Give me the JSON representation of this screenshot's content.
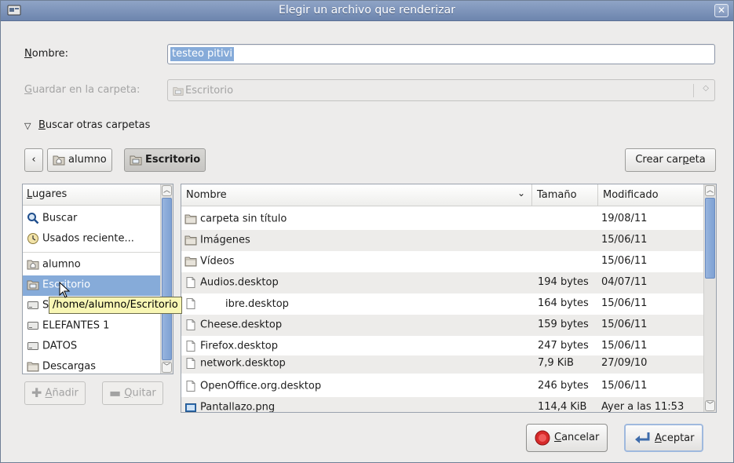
{
  "window": {
    "title": "Elegir un archivo que renderizar",
    "close_symbol": "✕"
  },
  "name_field": {
    "label_mnemonic": "N",
    "label_rest": "ombre:",
    "value": "testeo pitivi"
  },
  "save_folder": {
    "label_mnemonic": "G",
    "label_rest": "uardar en la carpeta:",
    "value": "Escritorio",
    "icon": "desktop-folder-icon"
  },
  "browse_toggle": {
    "mnemonic": "B",
    "rest": "uscar otras carpetas",
    "arrow": "▽"
  },
  "path_bar": {
    "back_symbol": "‹",
    "crumbs": [
      {
        "label": "alumno",
        "icon": "home-folder-icon"
      },
      {
        "label": "Escritorio",
        "icon": "desktop-folder-icon"
      }
    ],
    "create_folder_pre": "Crear car",
    "create_folder_mnemonic": "p",
    "create_folder_post": "eta"
  },
  "places": {
    "header_mnemonic": "L",
    "header_rest": "ugares",
    "items": [
      {
        "label": "Buscar",
        "icon": "search-icon"
      },
      {
        "label": "Usados reciente...",
        "icon": "recent-clock-icon"
      },
      {
        "label": "alumno",
        "icon": "home-folder-icon"
      },
      {
        "label": "Escritorio",
        "icon": "desktop-folder-icon"
      },
      {
        "label": "Siste",
        "icon": "drive-icon"
      },
      {
        "label": "ELEFANTES 1",
        "icon": "drive-icon"
      },
      {
        "label": "DATOS",
        "icon": "drive-icon"
      },
      {
        "label": "Descargas",
        "icon": "folder-icon"
      }
    ],
    "tooltip": "/home/alumno/Escritorio",
    "add_button": {
      "mnemonic": "A",
      "rest": "ñadir"
    },
    "remove_button": {
      "mnemonic": "Q",
      "rest": "uitar"
    }
  },
  "files": {
    "columns": {
      "name": "Nombre",
      "size": "Tamaño",
      "modified": "Modificado"
    },
    "rows": [
      {
        "name": "carpeta sin título",
        "size": "",
        "modified": "19/08/11",
        "icon": "folder-icon"
      },
      {
        "name": "Imágenes",
        "size": "",
        "modified": "15/06/11",
        "icon": "folder-icon"
      },
      {
        "name": "Vídeos",
        "size": "",
        "modified": "15/06/11",
        "icon": "folder-icon"
      },
      {
        "name": "Audios.desktop",
        "size": "194 bytes",
        "modified": "04/07/11",
        "icon": "file-icon"
      },
      {
        "name": "ibre.desktop",
        "size": "164 bytes",
        "modified": "15/06/11",
        "icon": "file-icon"
      },
      {
        "name": "Cheese.desktop",
        "size": "159 bytes",
        "modified": "15/06/11",
        "icon": "file-icon"
      },
      {
        "name": "Firefox.desktop",
        "size": "247 bytes",
        "modified": "15/06/11",
        "icon": "file-icon"
      },
      {
        "name": "network.desktop",
        "size": "7,9 KiB",
        "modified": "27/09/10",
        "icon": "file-icon"
      },
      {
        "name": "OpenOffice.org.desktop",
        "size": "246 bytes",
        "modified": "15/06/11",
        "icon": "file-icon"
      },
      {
        "name": "Pantallazo.png",
        "size": "114,4 KiB",
        "modified": "Ayer a las 11:53",
        "icon": "image-file-icon"
      }
    ]
  },
  "buttons": {
    "cancel": {
      "mnemonic": "C",
      "rest": "ancelar"
    },
    "accept": {
      "mnemonic": "A",
      "rest": "ceptar"
    }
  },
  "colors": {
    "selection": "#86abd9",
    "titlebar": "#7d93b9"
  }
}
